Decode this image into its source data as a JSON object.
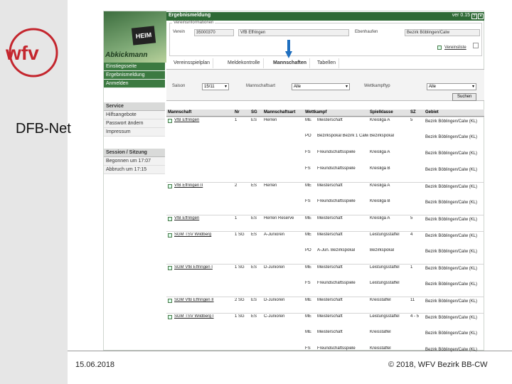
{
  "slide": {
    "brand": "wfv",
    "label": "DFB-Net",
    "date": "15.06.2018",
    "copyright": "© 2018, WFV Bezirk BB-CW"
  },
  "app": {
    "header_title": "Ergebnismeldung",
    "version": "ver 0.15",
    "photo_sign": "HEIM",
    "photo_caption": "Abkickmann",
    "nav": [
      "Einstiegsseite",
      "Ergebnismeldung",
      "Anmelden"
    ],
    "service": {
      "title": "Service",
      "items": [
        "Hilfsangebote",
        "Passwort ändern",
        "Impressum"
      ]
    },
    "session": {
      "title": "Session / Sitzung",
      "items": [
        "Begonnen um 17:07",
        "Abbruch um 17:15"
      ]
    },
    "vereinsinfo": {
      "title": "Vereinsinformationen",
      "verein_label": "Verein",
      "verein_nr": "35000370",
      "verein_name": "VfB Effringen",
      "ort_label": "Ebenhaufen",
      "bezirk": "Bezirk Böblingen/Calw",
      "link": "Vereinsliste"
    },
    "tabs": [
      "Vereinsspielplan",
      "Meldekontrolle",
      "Mannschaften",
      "Tabellen"
    ],
    "filters": {
      "saison_label": "Saison",
      "saison_value": "15/11",
      "mannschaftsart_label": "Mannschaftsart",
      "mannschaftsart_value": "Alle",
      "wettkampftyp_label": "Wettkampftyp",
      "wettkampftyp_value": "Alle",
      "search_button": "Suchen"
    },
    "table": {
      "headers": [
        "Mannschaft",
        "Nr",
        "SG",
        "Mannschaftsart",
        "Wettkampf",
        "Spielklasse",
        "SZ",
        "Gebiet"
      ],
      "rows": [
        [
          "VfB Effringen",
          "1",
          "ES",
          "Herren",
          "ME",
          "Meisterschaft",
          "Kreisliga A",
          "5",
          "Bezirk Böblingen/Calw (KL)"
        ],
        [
          "",
          "",
          "",
          "",
          "PO",
          "Bezirkspokal Bezirk 1 Calw",
          "Bezirkspokal",
          "",
          "Bezirk Böblingen/Calw (KL)"
        ],
        [
          "",
          "",
          "",
          "",
          "FS",
          "Freundschaftsspiele",
          "Kreisliga A",
          "",
          "Bezirk Böblingen/Calw (KL)"
        ],
        [
          "",
          "",
          "",
          "",
          "FS",
          "Freundschaftsspiele",
          "Kreisliga B",
          "",
          "Bezirk Böblingen/Calw (KL)"
        ],
        [
          "VfB Effringen II",
          "2",
          "ES",
          "Herren",
          "ME",
          "Meisterschaft",
          "Kreisliga A",
          "",
          "Bezirk Böblingen/Calw (KL)"
        ],
        [
          "",
          "",
          "",
          "",
          "FS",
          "Freundschaftsspiele",
          "Kreisliga B",
          "",
          "Bezirk Böblingen/Calw (KL)"
        ],
        [
          "VfB Effringen",
          "1",
          "ES",
          "Herren Reserve",
          "ME",
          "Meisterschaft",
          "Kreisliga A",
          "5",
          "Bezirk Böblingen/Calw (KL)"
        ],
        [
          "SGM TSV Wildberg",
          "1 SG",
          "ES",
          "A-Junioren",
          "ME",
          "Meisterschaft",
          "Leistungsstaffel",
          "4",
          "Bezirk Böblingen/Calw (KL)"
        ],
        [
          "",
          "",
          "",
          "",
          "PO",
          "A-Jun. Bezirkspokal",
          "Bezirkspokal",
          "",
          "Bezirk Böblingen/Calw (KL)"
        ],
        [
          "SGM VfB Effringen I",
          "1 SG",
          "ES",
          "D-Junioren",
          "ME",
          "Meisterschaft",
          "Leistungsstaffel",
          "1",
          "Bezirk Böblingen/Calw (KL)"
        ],
        [
          "",
          "",
          "",
          "",
          "FS",
          "Freundschaftsspiele",
          "Leistungsstaffel",
          "",
          "Bezirk Böblingen/Calw (KL)"
        ],
        [
          "SGM VfB Effringen II",
          "2 SG",
          "ES",
          "D-Junioren",
          "ME",
          "Meisterschaft",
          "Kreisstaffel",
          "11",
          "Bezirk Böblingen/Calw (KL)"
        ],
        [
          "SGM TSV Wildberg I",
          "1 SG",
          "ES",
          "C-Junioren",
          "ME",
          "Meisterschaft",
          "Leistungsstaffel",
          "4 - 5",
          "Bezirk Böblingen/Calw (KL)"
        ],
        [
          "",
          "",
          "",
          "",
          "ME",
          "Meisterschaft",
          "Kreisstaffel",
          "",
          "Bezirk Böblingen/Calw (KL)"
        ],
        [
          "",
          "",
          "",
          "",
          "FS",
          "Freundschaftsspiele",
          "Kreisstaffel",
          "",
          "Bezirk Böblingen/Calw (KL)"
        ]
      ]
    }
  },
  "colors": {
    "accent": "#c4262e",
    "nav": "#3c7a41",
    "arrow": "#1f6fbf"
  }
}
